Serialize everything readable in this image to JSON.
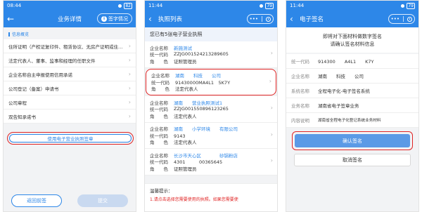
{
  "status_bars": [
    {
      "time": "08:44",
      "battery": "82"
    },
    {
      "time": "11:44",
      "battery": "79"
    },
    {
      "time": "11:44",
      "battery": "79"
    }
  ],
  "phone1": {
    "back_icon": "arrow-left-icon",
    "title": "业务详情",
    "sign_status": "签字情况",
    "section_title": "信息概览",
    "items": [
      "住所证明（产权证复印件、租赁协议、无房产证明或住…",
      "法定代表人、董事、监事和经理的任职文件",
      "企业名称自主申报使用信用承诺",
      "公司登记（备案）申请书",
      "公司章程",
      "双告知承诺书"
    ],
    "use_license_button": "使用电子营业执照签章",
    "back_sign_button": "返回前签",
    "submit_button": "提交"
  },
  "phone2": {
    "title": "执照列表",
    "notice": "您已有5张电子营业执照",
    "labels": {
      "name": "企业名称",
      "code": "统一代码",
      "role": "角　　色"
    },
    "cards": [
      {
        "name": "新施测试",
        "code": "ZZJG001524213289605",
        "role": "证照管理员"
      },
      {
        "name": "湖南　　科技　　公司",
        "code": "91430000MA4L1　5K7Y",
        "role": "法定代表人"
      },
      {
        "name": "湖南　　营业执照测试1",
        "code": "ZZJG001550896123265",
        "role": "法定代表人"
      },
      {
        "name": "湖南　　小学环境　　有限公司",
        "code": "9143　　　　　　　　",
        "role": "法定代表人"
      },
      {
        "name": "长沙市天心区　　　　砂锅粉店",
        "code": "4301　　　00365645",
        "role": "证照管理员"
      }
    ],
    "tips_title": "温馨提示：",
    "tip1": "1.请点击选择您需要使用的执照。如果您需要使"
  },
  "phone3": {
    "title": "电子签名",
    "header_line1": "即将对下面材料做数字签名",
    "header_line2": "请确认签名材料信息",
    "rows": [
      {
        "label": "统一代码",
        "value": "914300　　A4L1　　K7Y"
      },
      {
        "label": "企业名称",
        "value": "湖南　　科技　　公司"
      },
      {
        "label": "系统名称",
        "value": "全程电子化-电子签名系统"
      },
      {
        "label": "业务名称",
        "value": "湖南省电子签章业务"
      },
      {
        "label": "内容说明",
        "value": "湖南省全程电子化登记系统业务材料"
      }
    ],
    "confirm_button": "确认签名",
    "cancel_button": "取消签名"
  },
  "colors": {
    "brand": "#2d87e8",
    "highlight": "#e02424"
  }
}
